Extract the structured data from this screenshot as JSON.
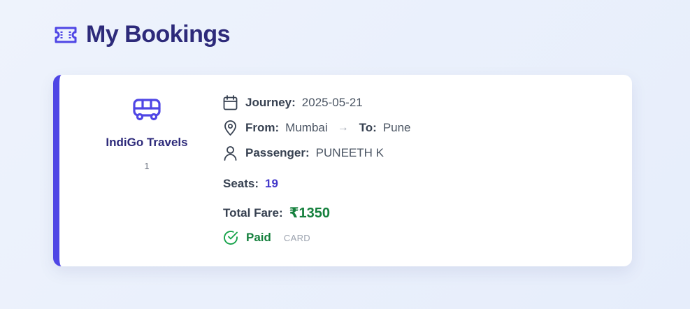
{
  "header": {
    "title": "My Bookings",
    "icon": "ticket-icon"
  },
  "booking": {
    "operator": {
      "icon": "bus-icon",
      "name": "IndiGo Travels",
      "sub": "1"
    },
    "journey": {
      "label": "Journey:",
      "value": "2025-05-21",
      "icon": "calendar-icon"
    },
    "route": {
      "icon": "map-pin-icon",
      "from_label": "From:",
      "from_value": "Mumbai",
      "arrow": "→",
      "to_label": "To:",
      "to_value": "Pune"
    },
    "passenger": {
      "label": "Passenger:",
      "value": "PUNEETH K",
      "icon": "user-icon"
    },
    "seats": {
      "label": "Seats:",
      "value": "19"
    },
    "fare": {
      "label": "Total Fare:",
      "value": "₹1350"
    },
    "payment": {
      "status": "Paid",
      "method": "CARD",
      "icon": "check-circle-icon"
    }
  },
  "colors": {
    "accent": "#4f46e5",
    "title": "#2d2a7a",
    "success": "#15803d"
  }
}
